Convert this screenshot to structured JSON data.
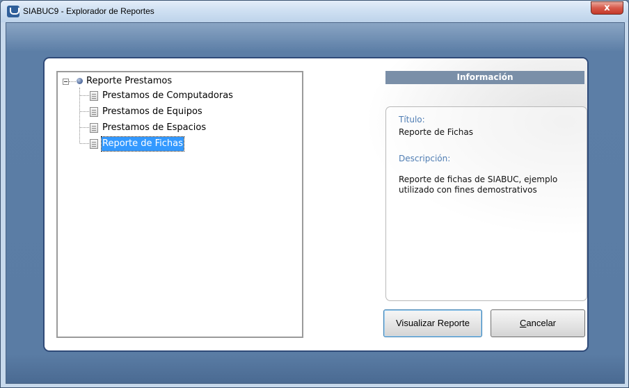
{
  "window": {
    "title": "SIABUC9 - Explorador de Reportes",
    "close_glyph": "x"
  },
  "tree": {
    "root": {
      "label": "Reporte Prestamos",
      "icon": "root-node-bullet-icon"
    },
    "items": [
      {
        "label": "Prestamos de Computadoras",
        "selected": false
      },
      {
        "label": "Prestamos de Equipos",
        "selected": false
      },
      {
        "label": "Prestamos de Espacios",
        "selected": false
      },
      {
        "label": "Reporte de Fichas",
        "selected": true
      }
    ]
  },
  "info": {
    "header": "Información",
    "title_label": "Título:",
    "title_value": "Reporte de Fichas",
    "description_label": "Descripción:",
    "description_value": "Reporte de fichas de SIABUC, ejemplo utilizado con fines demostrativos"
  },
  "buttons": {
    "view": "Visualizar Reporte",
    "cancel_accel": "C",
    "cancel_rest": "ancelar"
  },
  "colors": {
    "selection": "#3399ff",
    "info_header_bg": "#7a8fa8",
    "info_label": "#4f7db3",
    "panel_border": "#2f4a78"
  }
}
